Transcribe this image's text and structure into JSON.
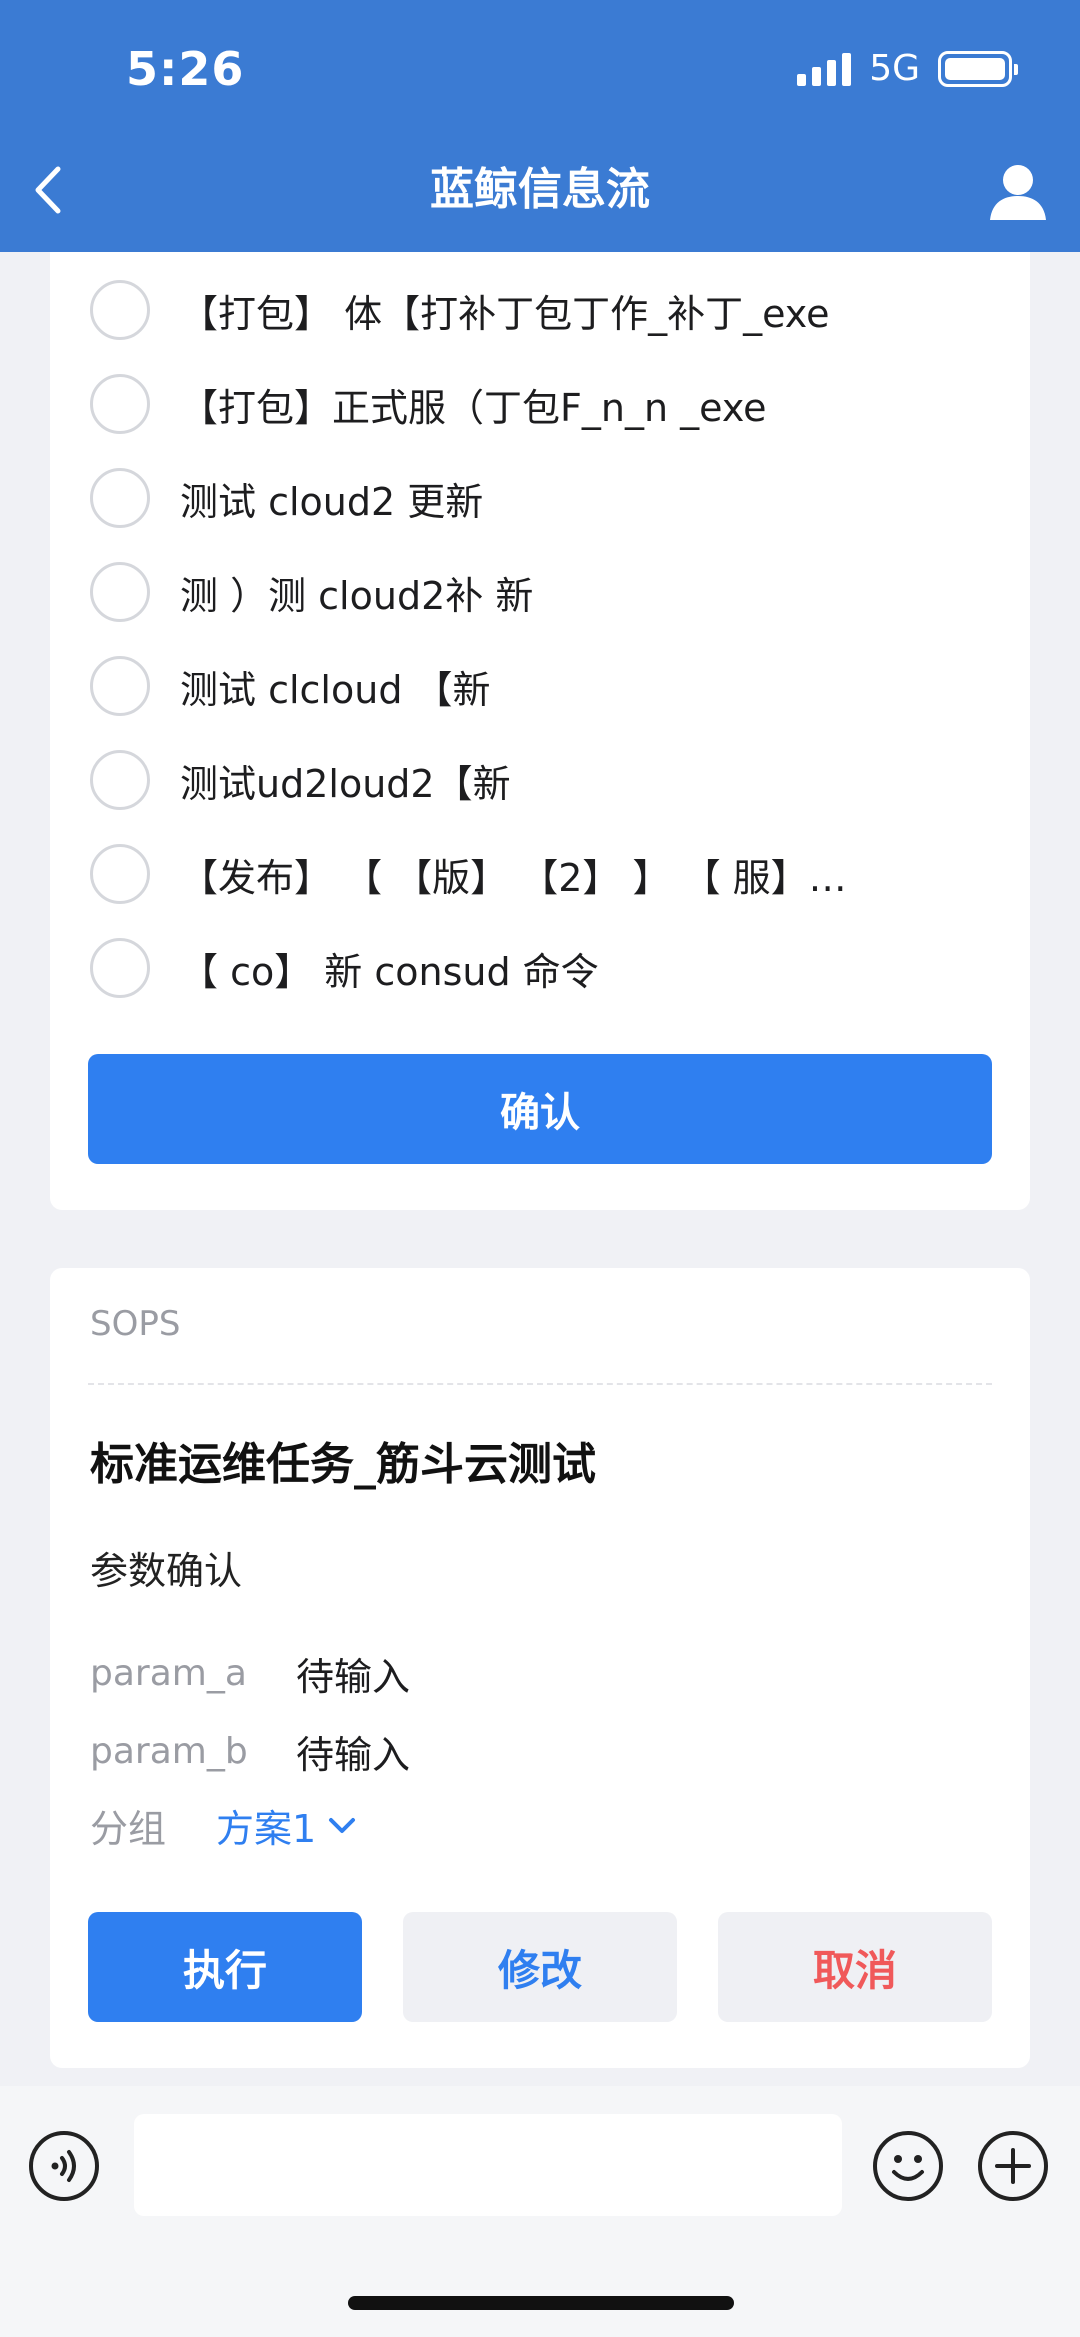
{
  "status_bar": {
    "time": "5:26",
    "network": "5G"
  },
  "nav": {
    "title": "蓝鲸信息流"
  },
  "options": [
    {
      "label": "【打包】 体【打补丁包丁作_补丁_exe"
    },
    {
      "label": "【打包】正式服（丁包F_n_n _exe"
    },
    {
      "label": "测试 cloud2 更新"
    },
    {
      "label": "测 ）测 cloud2补 新"
    },
    {
      "label": "测试 clcloud 【新"
    },
    {
      "label": "测试ud2loud2【新"
    },
    {
      "label": "【发布】 【 【版】 【2】 】 【 服】…"
    },
    {
      "label": "【 co】 新 consud 命令"
    }
  ],
  "confirm_label": "确认",
  "sops": {
    "source": "SOPS",
    "title": "标准运维任务_筋斗云测试",
    "section": "参数确认",
    "params": [
      {
        "key": "param_a",
        "value": "待输入"
      },
      {
        "key": "param_b",
        "value": "待输入"
      }
    ],
    "group_key": "分组",
    "group_value": "方案1",
    "buttons": {
      "execute": "执行",
      "edit": "修改",
      "cancel": "取消"
    }
  },
  "input": {
    "placeholder": ""
  },
  "colors": {
    "header": "#3b7bd3",
    "primary": "#2f7ff0",
    "danger": "#f0595a"
  }
}
